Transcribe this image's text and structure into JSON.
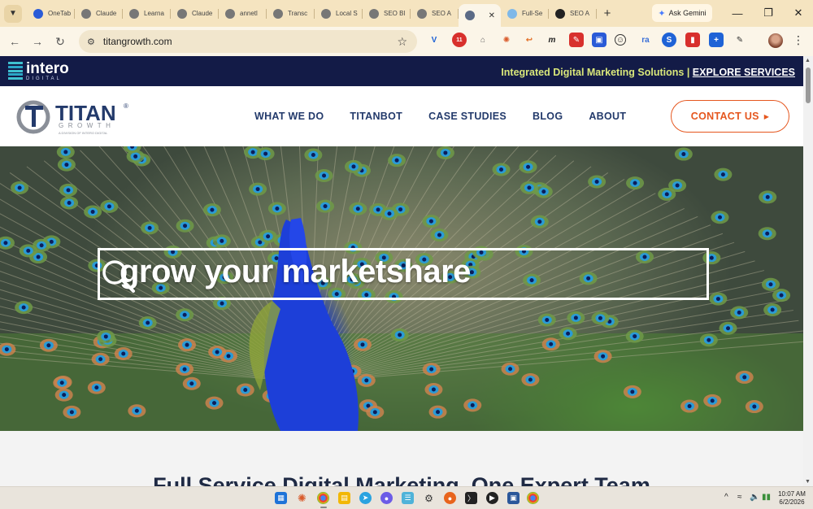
{
  "browser": {
    "tabs": [
      {
        "label": "OneTab",
        "icon": "onetab-icon",
        "color": "#2a5bd7"
      },
      {
        "label": "Claude",
        "icon": "globe-icon",
        "color": "#777777"
      },
      {
        "label": "Learna",
        "icon": "globe-icon",
        "color": "#777777"
      },
      {
        "label": "Claude",
        "icon": "globe-icon",
        "color": "#777777"
      },
      {
        "label": "annetl",
        "icon": "globe-icon",
        "color": "#777777"
      },
      {
        "label": "Transc",
        "icon": "globe-icon",
        "color": "#777777"
      },
      {
        "label": "Local S",
        "icon": "globe-icon",
        "color": "#777777"
      },
      {
        "label": "SEO Bl",
        "icon": "globe-icon",
        "color": "#777777"
      },
      {
        "label": "SEO A",
        "icon": "globe-icon",
        "color": "#777777"
      },
      {
        "label": "",
        "icon": "titan-favicon-icon",
        "color": "#5b6a86",
        "active": true
      },
      {
        "label": "Full-Se",
        "icon": "landscape-icon",
        "color": "#7fb8e8"
      },
      {
        "label": "SEO A",
        "icon": "dm-icon",
        "color": "#222222"
      }
    ],
    "ask_gemini": "Ask Gemini",
    "url": "titangrowth.com",
    "extension_badges": {
      "badge_a": "11",
      "badge_b": "17"
    }
  },
  "site": {
    "topbar": {
      "logo_word": "intero",
      "logo_sub": "DIGITAL",
      "promo_text": "Integrated Digital Marketing Solutions | ",
      "promo_link": "EXPLORE SERVICES"
    },
    "logo": {
      "name": "TITAN",
      "sub": "GROWTH",
      "tagline": "A DIVISION OF INTERO DIGITAL",
      "reg": "®"
    },
    "nav": [
      "WHAT WE DO",
      "TITANBOT",
      "CASE STUDIES",
      "BLOG",
      "ABOUT"
    ],
    "contact": "CONTACT US",
    "hero_text": "grow your marketshare",
    "headline": "Full Service Digital Marketing. One Expert Team"
  },
  "taskbar": {
    "time": "10:07 AM",
    "date": "6/2/2026"
  },
  "colors": {
    "navy": "#131b47",
    "accent_orange": "#e5561e",
    "nav_blue": "#233a6b",
    "promo_yellow": "#d9e77a"
  }
}
